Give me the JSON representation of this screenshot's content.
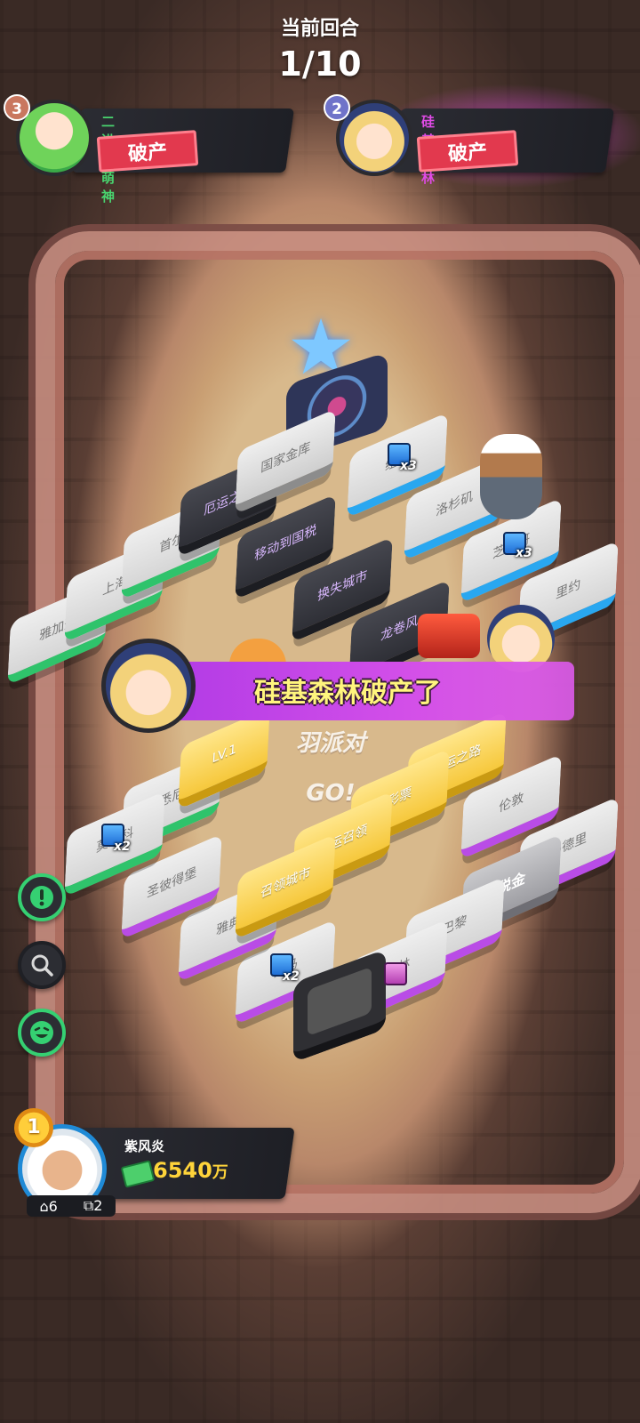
{
  "round": {
    "label": "当前回合",
    "value": "1/10"
  },
  "players": {
    "left": {
      "rank": "3",
      "name": "二进制萌神",
      "status": "破产",
      "rank_color": "#c9775f",
      "name_color": "#49d46f"
    },
    "right": {
      "rank": "2",
      "name": "硅基森林",
      "status": "破产",
      "rank_color": "#6f73c9",
      "name_color": "#e04be6"
    }
  },
  "banner": {
    "text": "硅基森林破产了"
  },
  "board": {
    "logo": "羽派对 GO!",
    "tiles": [
      {
        "key": "t1",
        "label": "雅加达",
        "color": "green"
      },
      {
        "key": "t2",
        "label": "上海",
        "color": "green"
      },
      {
        "key": "t3",
        "label": "首尔",
        "color": "green"
      },
      {
        "key": "t4",
        "label": "厄运之路",
        "color": "dark"
      },
      {
        "key": "t5",
        "label": "移动到国税",
        "color": "dark"
      },
      {
        "key": "t6",
        "label": "换失城市",
        "color": "dark"
      },
      {
        "key": "t7",
        "label": "龙卷风",
        "color": "dark"
      },
      {
        "key": "t8",
        "label": "国家金库",
        "color": "gray"
      },
      {
        "key": "t9",
        "label": "纽约",
        "color": "blue"
      },
      {
        "key": "t10",
        "label": "洛杉矶",
        "color": "blue"
      },
      {
        "key": "t11",
        "label": "芝加哥",
        "color": "blue"
      },
      {
        "key": "t12",
        "label": "里约",
        "color": "blue"
      },
      {
        "key": "t13",
        "label": "幸运之路",
        "color": "yellow"
      },
      {
        "key": "t14",
        "label": "伦敦",
        "color": "purple"
      },
      {
        "key": "t15",
        "label": "马德里",
        "color": "purple"
      },
      {
        "key": "t16",
        "label": "税金",
        "color": "tax"
      },
      {
        "key": "t17",
        "label": "巴黎",
        "color": "purple"
      },
      {
        "key": "t18",
        "label": "柏林",
        "color": "purple"
      },
      {
        "key": "t19",
        "label": "罗马",
        "color": "purple"
      },
      {
        "key": "t20",
        "label": "雅典",
        "color": "purple"
      },
      {
        "key": "t21",
        "label": "圣彼得堡",
        "color": "purple"
      },
      {
        "key": "t22",
        "label": "悉尼",
        "color": "green"
      },
      {
        "key": "t23",
        "label": "彩票",
        "color": "yellow"
      },
      {
        "key": "t24",
        "label": "幸运召领",
        "color": "yellow"
      },
      {
        "key": "t25",
        "label": "召领城市",
        "color": "yellow"
      },
      {
        "key": "t26",
        "label": "莫斯科",
        "color": "green"
      }
    ],
    "level_label": "LV.1",
    "multipliers": [
      "x3",
      "x3",
      "x2",
      "x2"
    ]
  },
  "side_buttons": [
    {
      "icon": "alert-icon",
      "label": ""
    },
    {
      "icon": "search-icon",
      "label": ""
    },
    {
      "icon": "emoji-icon",
      "label": ""
    }
  ],
  "me": {
    "rank": "1",
    "name": "紫风炎",
    "money": "6540",
    "money_unit": "万",
    "houses": "6",
    "cards": "2"
  },
  "colors": {
    "green": "#2fc36b",
    "blue": "#29a7f0",
    "purple": "#b94ce6",
    "yellow": "#f6c83c",
    "banner": "#c544e8",
    "money": "#ffd43a"
  }
}
